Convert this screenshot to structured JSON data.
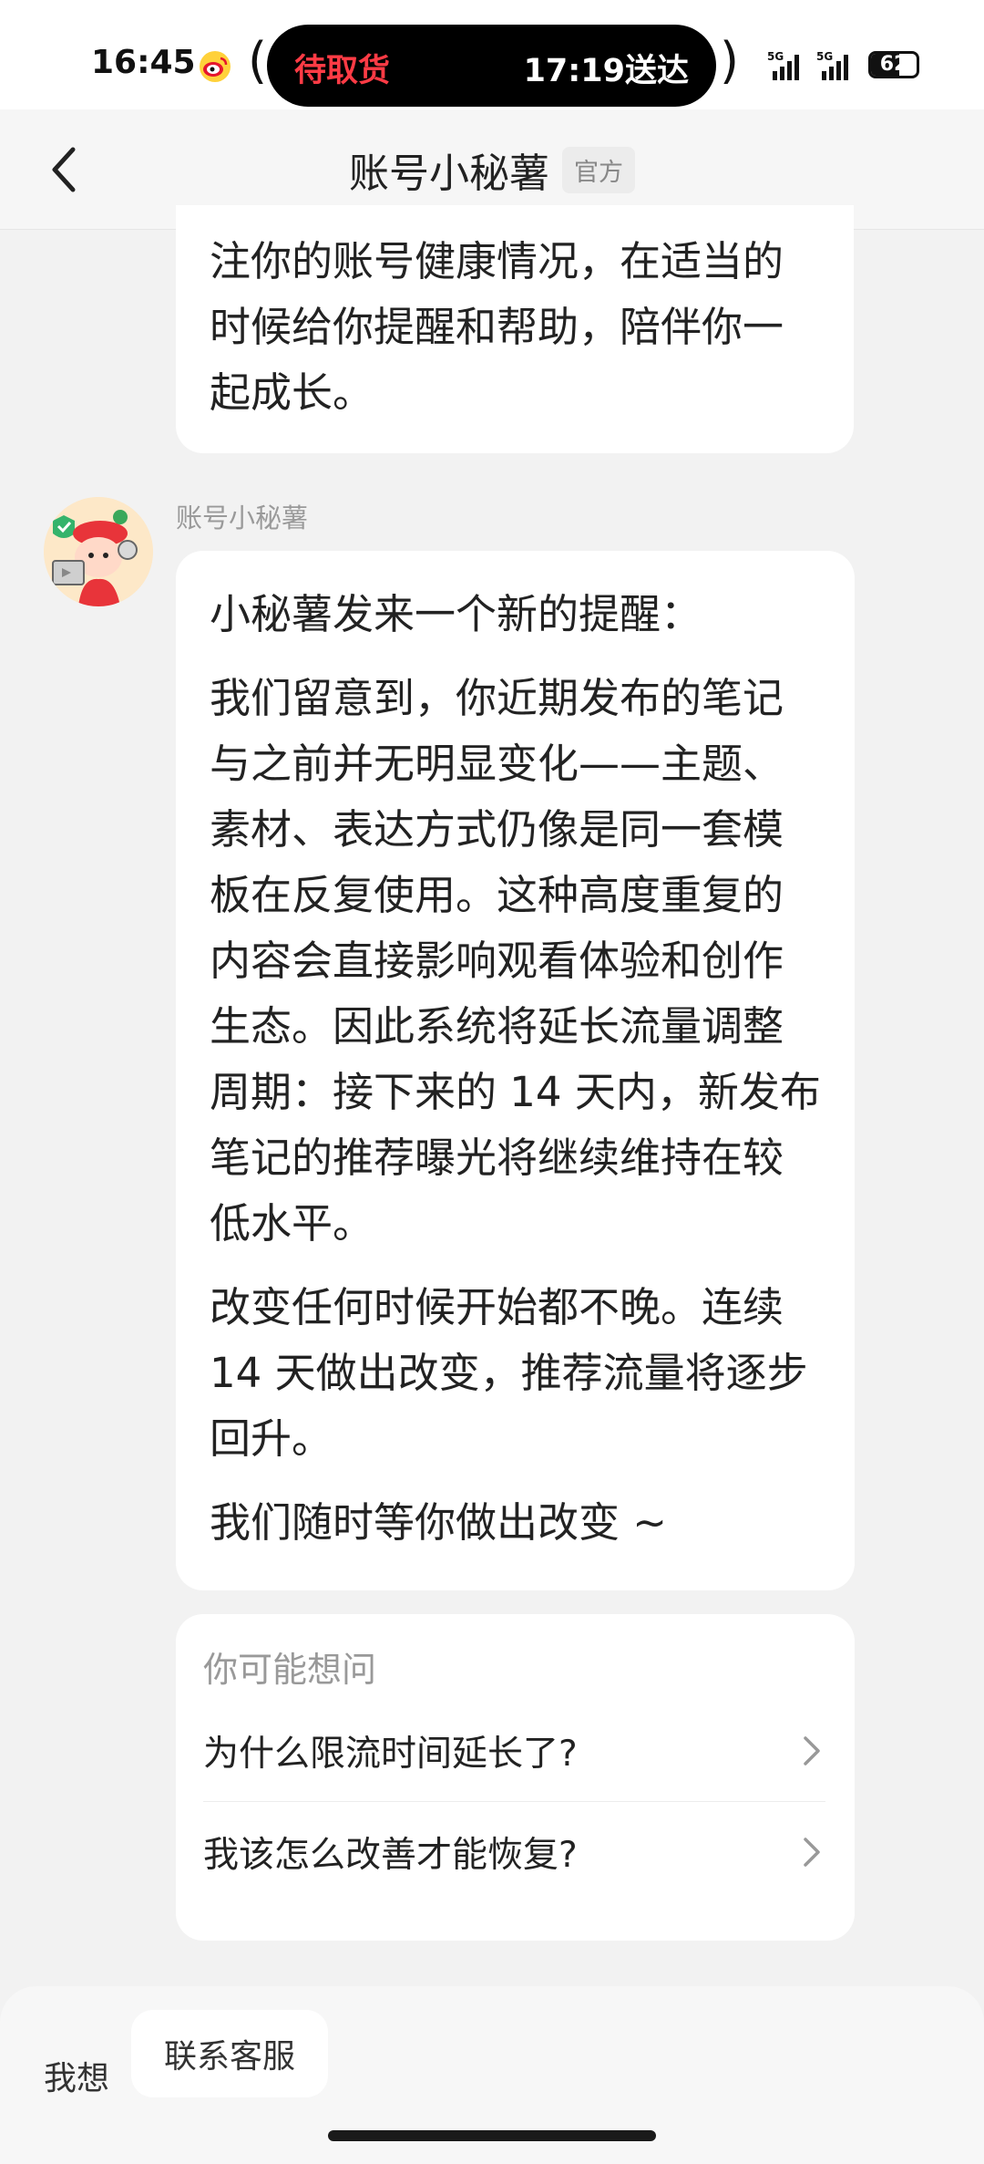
{
  "status_bar": {
    "time": "16:45",
    "island_left": "待取货",
    "island_right": "17:19送达",
    "signal_label_1": "5G",
    "signal_label_2": "5G",
    "battery": "62",
    "battery_level": 0.62
  },
  "header": {
    "title": "账号小秘薯",
    "badge": "官方"
  },
  "messages": {
    "prev_bubble_text": "注你的账号健康情况，在适当的时候给你提醒和帮助，陪伴你一起成长。",
    "sender_name": "账号小秘薯",
    "main_bubble": {
      "p1": "小秘薯发来一个新的提醒：",
      "p2": "我们留意到，你近期发布的笔记与之前并无明显变化——主题、素材、表达方式仍像是同一套模板在反复使用。这种高度重复的内容会直接影响观看体验和创作生态。因此系统将延长流量调整周期：接下来的 14 天内，新发布笔记的推荐曝光将继续维持在较低水平。",
      "p3": "改变任何时候开始都不晚。连续 14 天做出改变，推荐流量将逐步回升。",
      "p4": "我们随时等你做出改变 ~"
    }
  },
  "suggestions": {
    "title": "你可能想问",
    "items": [
      {
        "label": "为什么限流时间延长了?"
      },
      {
        "label": "我该怎么改善才能恢复?"
      }
    ]
  },
  "bottom_bar": {
    "label": "我想",
    "contact_button": "联系客服"
  },
  "colors": {
    "accent_red": "#ff3b45",
    "background": "#f2f2f2",
    "bubble": "#ffffff"
  },
  "icons": {
    "back": "chevron-left-icon",
    "suggestion_arrow": "chevron-right-icon",
    "weibo": "weibo-icon"
  }
}
